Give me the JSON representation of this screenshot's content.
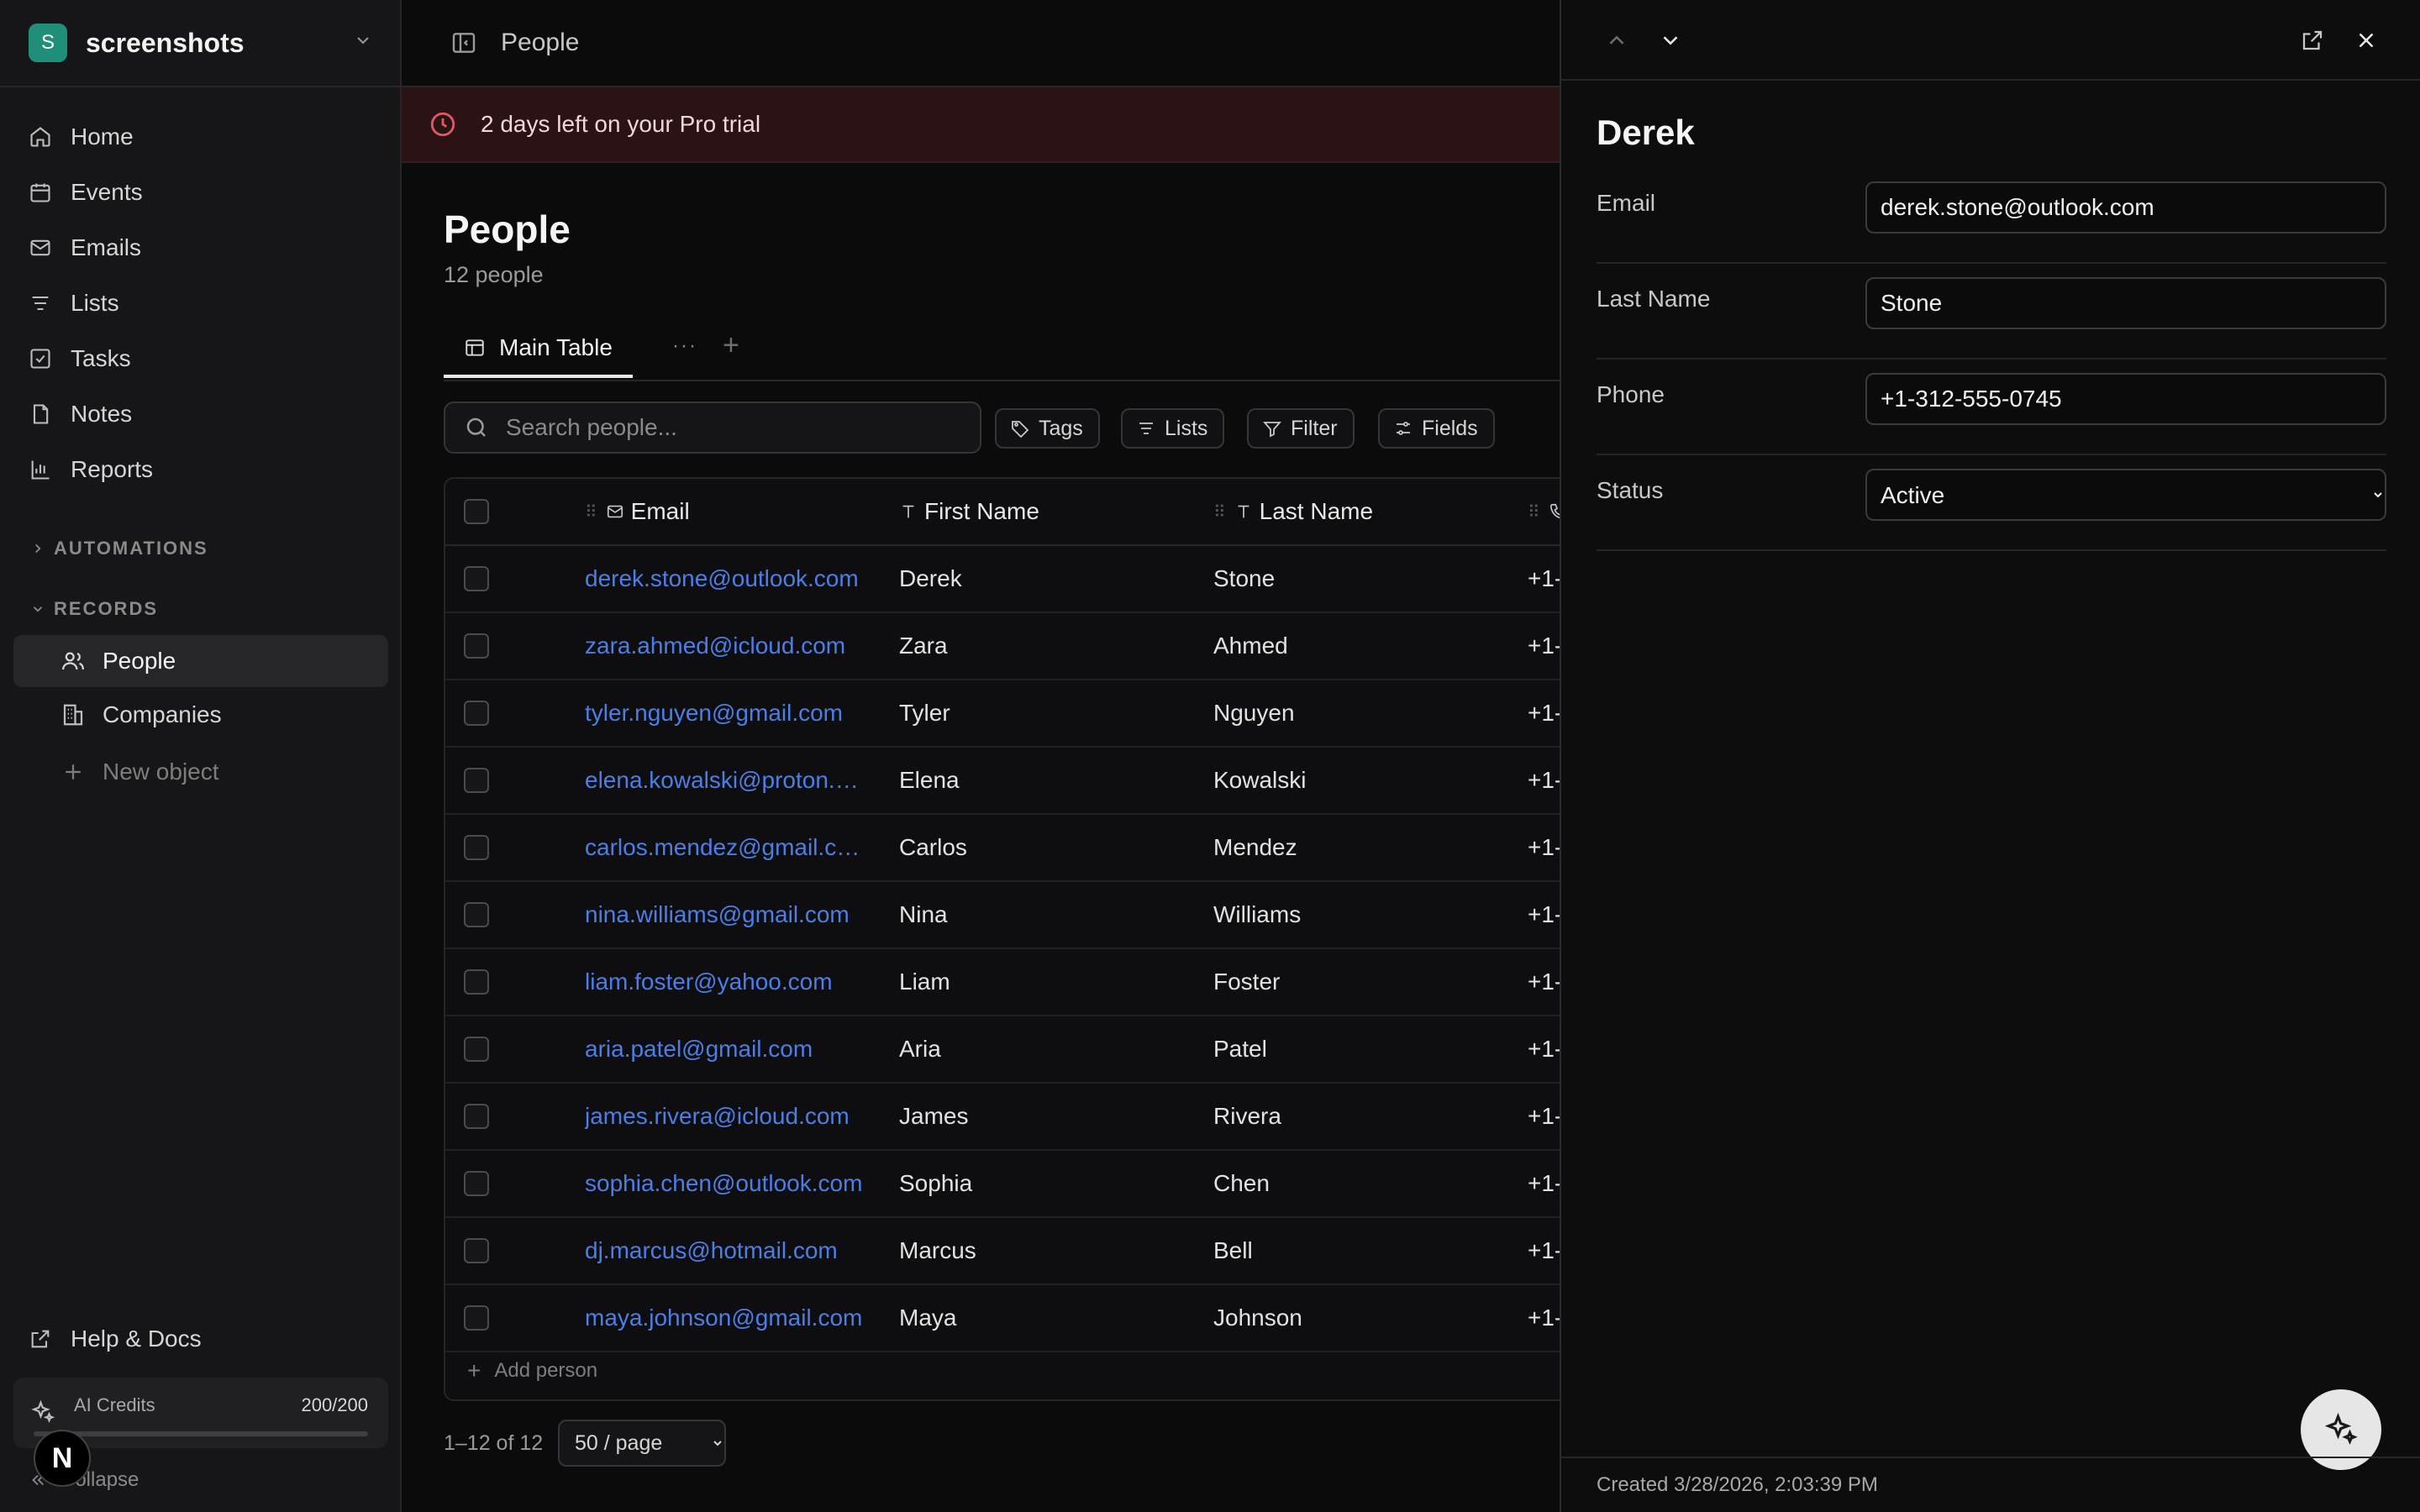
{
  "workspace": {
    "initial": "S",
    "name": "screenshots"
  },
  "sidebar": {
    "items": [
      {
        "label": "Home",
        "icon": "home-icon"
      },
      {
        "label": "Events",
        "icon": "calendar-icon"
      },
      {
        "label": "Emails",
        "icon": "mail-icon"
      },
      {
        "label": "Lists",
        "icon": "list-icon"
      },
      {
        "label": "Tasks",
        "icon": "task-icon"
      },
      {
        "label": "Notes",
        "icon": "note-icon"
      },
      {
        "label": "Reports",
        "icon": "chart-icon"
      }
    ],
    "automations_label": "AUTOMATIONS",
    "records_label": "RECORDS",
    "records": [
      {
        "label": "People",
        "icon": "people-icon",
        "active": true
      },
      {
        "label": "Companies",
        "icon": "building-icon",
        "active": false
      }
    ],
    "new_object_label": "New object",
    "help_label": "Help & Docs",
    "ai_credits": {
      "label": "AI Credits",
      "value": "200/200",
      "fraction": 1.0
    },
    "collapse_label": "Collapse",
    "badge_letter": "N"
  },
  "topbar": {
    "title": "People"
  },
  "trial_banner": {
    "text": "2 days left on your Pro trial",
    "color": "#e05a66"
  },
  "page": {
    "title": "People",
    "count": "12 people"
  },
  "tabs": {
    "main": "Main Table",
    "more": "···",
    "add": "+"
  },
  "toolbar": {
    "search_placeholder": "Search people...",
    "tags": "Tags",
    "lists": "Lists",
    "filter": "Filter",
    "fields": "Fields"
  },
  "table": {
    "headers": {
      "email": "Email",
      "first": "First Name",
      "last": "Last Name"
    },
    "rows": [
      {
        "email": "derek.stone@outlook.com",
        "first": "Derek",
        "last": "Stone",
        "phone": "+1-"
      },
      {
        "email": "zara.ahmed@icloud.com",
        "first": "Zara",
        "last": "Ahmed",
        "phone": "+1-"
      },
      {
        "email": "tyler.nguyen@gmail.com",
        "first": "Tyler",
        "last": "Nguyen",
        "phone": "+1-"
      },
      {
        "email": "elena.kowalski@proton.…",
        "first": "Elena",
        "last": "Kowalski",
        "phone": "+1-"
      },
      {
        "email": "carlos.mendez@gmail.c…",
        "first": "Carlos",
        "last": "Mendez",
        "phone": "+1-"
      },
      {
        "email": "nina.williams@gmail.com",
        "first": "Nina",
        "last": "Williams",
        "phone": "+1-"
      },
      {
        "email": "liam.foster@yahoo.com",
        "first": "Liam",
        "last": "Foster",
        "phone": "+1-"
      },
      {
        "email": "aria.patel@gmail.com",
        "first": "Aria",
        "last": "Patel",
        "phone": "+1-"
      },
      {
        "email": "james.rivera@icloud.com",
        "first": "James",
        "last": "Rivera",
        "phone": "+1-"
      },
      {
        "email": "sophia.chen@outlook.com",
        "first": "Sophia",
        "last": "Chen",
        "phone": "+1-"
      },
      {
        "email": "dj.marcus@hotmail.com",
        "first": "Marcus",
        "last": "Bell",
        "phone": "+1-"
      },
      {
        "email": "maya.johnson@gmail.com",
        "first": "Maya",
        "last": "Johnson",
        "phone": "+1-"
      }
    ],
    "add_label": "Add person",
    "link_color": "#4b7fe6"
  },
  "pagination": {
    "range": "1–12 of 12",
    "per_page": "50 / page"
  },
  "panel": {
    "name": "Derek",
    "fields": {
      "email": {
        "label": "Email",
        "value": "derek.stone@outlook.com"
      },
      "last_name": {
        "label": "Last Name",
        "value": "Stone"
      },
      "phone": {
        "label": "Phone",
        "value": "+1-312-555-0745"
      },
      "status": {
        "label": "Status",
        "value": "Active"
      }
    },
    "created": "Created 3/28/2026, 2:03:39 PM"
  }
}
